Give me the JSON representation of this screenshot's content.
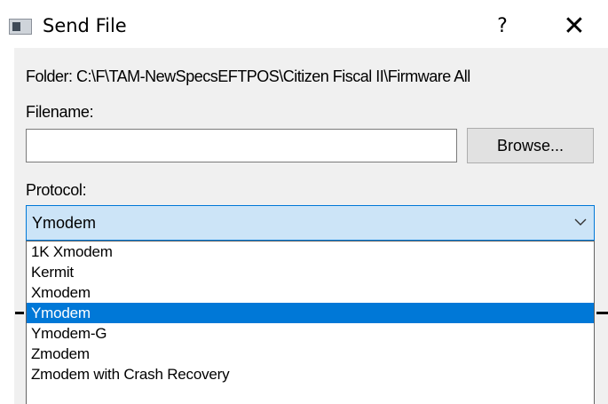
{
  "window": {
    "title": "Send File",
    "help_label": "?",
    "close_label": "✕"
  },
  "form": {
    "folder_text": "Folder:  C:\\F\\TAM-NewSpecsEFTPOS\\Citizen Fiscal II\\Firmware All",
    "filename_label": "Filename:",
    "filename_value": "",
    "browse_label": "Browse...",
    "protocol_label": "Protocol:",
    "protocol_selected": "Ymodem"
  },
  "dropdown": {
    "options": [
      "1K Xmodem",
      "Kermit",
      "Xmodem",
      "Ymodem",
      "Ymodem-G",
      "Zmodem",
      "Zmodem with Crash Recovery"
    ],
    "highlighted_index": 3
  },
  "colors": {
    "accent": "#0078d7",
    "select_background": "#cce4f7",
    "dialog_background": "#f0f0f0"
  }
}
